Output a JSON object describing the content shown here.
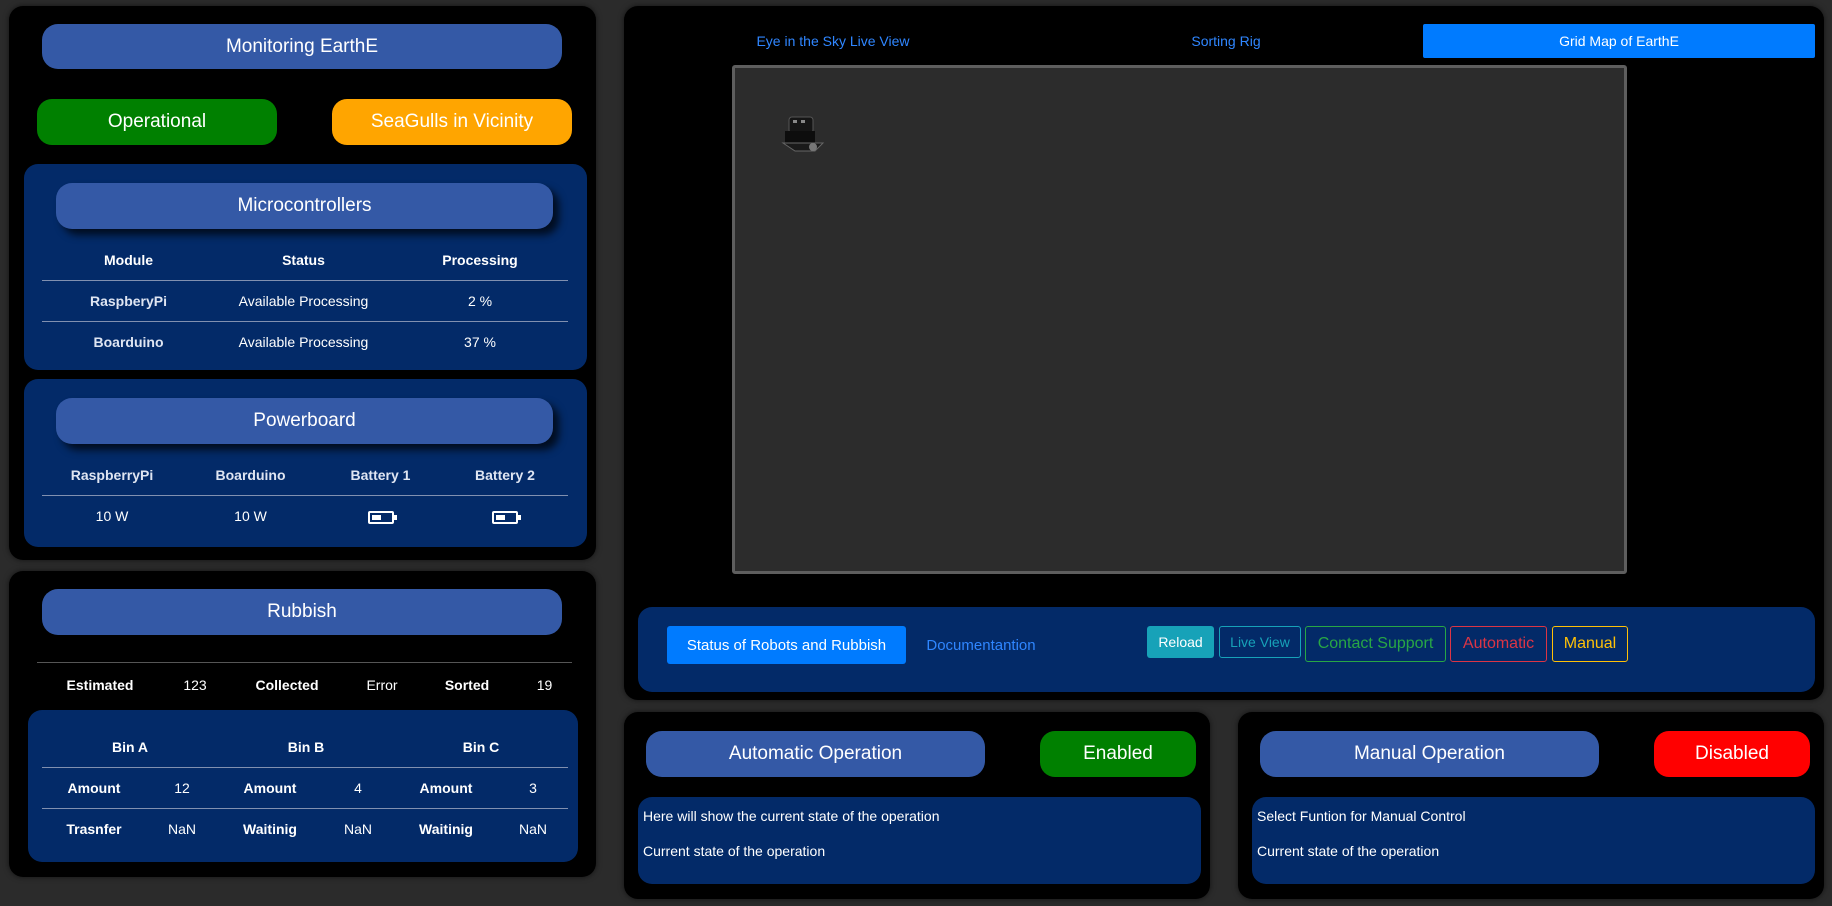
{
  "monitoring": {
    "title": "Monitoring EarthE",
    "status_operational": "Operational",
    "status_seagulls": "SeaGulls in Vicinity"
  },
  "microcontrollers": {
    "title": "Microcontrollers",
    "headers": [
      "Module",
      "Status",
      "Processing"
    ],
    "rows": [
      [
        "RaspberyPi",
        "Available Processing",
        "2 %"
      ],
      [
        "Boarduino",
        "Available Processing",
        "37 %"
      ]
    ]
  },
  "powerboard": {
    "title": "Powerboard",
    "headers": [
      "RaspberryPi",
      "Boarduino",
      "Battery 1",
      "Battery 2"
    ],
    "values": [
      "10 W",
      "10 W"
    ],
    "battery_icons": [
      "battery-icon",
      "battery-icon"
    ]
  },
  "rubbish": {
    "title": "Rubbish",
    "summary": {
      "estimated_label": "Estimated",
      "estimated_value": "123",
      "collected_label": "Collected",
      "collected_value": "Error",
      "sorted_label": "Sorted",
      "sorted_value": "19"
    },
    "bins": {
      "headers": [
        "Bin A",
        "Bin B",
        "Bin C"
      ],
      "amount_row": [
        "Amount",
        "12",
        "Amount",
        "4",
        "Amount",
        "3"
      ],
      "state_row": [
        "Trasnfer",
        "NaN",
        "Waitinig",
        "NaN",
        "Waitinig",
        "NaN"
      ]
    }
  },
  "top_tabs": {
    "eye": "Eye in the Sky Live View",
    "sorting": "Sorting Rig",
    "grid": "Grid Map of EarthE"
  },
  "toolbar": {
    "status_tab": "Status of Robots and Rubbish",
    "doc_tab": "Documentantion",
    "reload": "Reload",
    "live_view": "Live View",
    "contact_support": "Contact Support",
    "automatic": "Automatic",
    "manual": "Manual"
  },
  "auto_op": {
    "title": "Automatic Operation",
    "status": "Enabled",
    "line1": "Here will show the current state of the operation",
    "line2": "Current state of the operation"
  },
  "manual_op": {
    "title": "Manual Operation",
    "status": "Disabled",
    "line1": "Select Funtion for Manual Control",
    "line2": "Current state of the operation"
  },
  "colors": {
    "operational": "#008000",
    "seagulls": "#ffa500",
    "enabled": "#008000",
    "disabled": "#ff0000",
    "active_tab": "#007bff",
    "card": "#032a68",
    "pill": "#3459a6"
  }
}
